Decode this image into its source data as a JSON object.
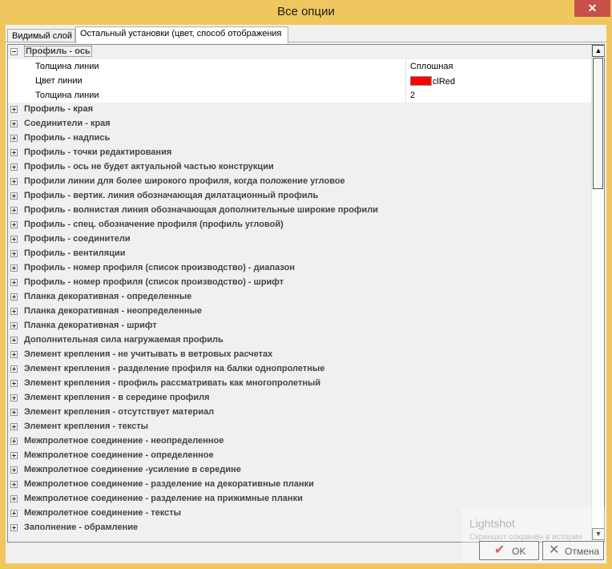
{
  "window": {
    "title": "Все опции",
    "close_glyph": "✕"
  },
  "tabs": [
    {
      "label": "Видимый слой",
      "active": false
    },
    {
      "label": "Остальный установки (цвет, способ отображения",
      "active": true
    }
  ],
  "tree": {
    "expanded_category": {
      "label": "Профиль - ось",
      "properties": [
        {
          "name": "Толщина линии",
          "value": "Сплошная"
        },
        {
          "name": "Цвет линии",
          "value": "clRed",
          "swatch_color": "#ff0000"
        },
        {
          "name": "Толщина линии",
          "value": "2"
        }
      ]
    },
    "categories": [
      "Профиль - края",
      "Соединители - края",
      "Профиль - надпись",
      "Профиль - точки редактирования",
      "Профиль - ось не будет актуальной частью конструкции",
      "Профили линии для более широкого профиля, когда положение угловое",
      "Профиль - вертик. линия обозначающая дилатационный профиль",
      "Профиль - волнистая линия обозначающая дополнительные широкие профили",
      "Профиль - спец. обозначение профиля (профиль угловой)",
      "Профиль - соединители",
      "Профиль - вентиляции",
      "Профиль - номер профиля (список производство) - диапазон",
      "Профиль - номер профиля (список производство) - шрифт",
      "Планка декоративная - определенные",
      "Планка декоративная - неопределенные",
      "Планка декоративная - шрифт",
      "Дополнительная сила нагружаемая профиль",
      "Элемент крепления - не учитывать в ветровых расчетах",
      "Элемент крепления - разделение профиля на балки однопролетные",
      "Элемент крепления - профиль рассматривать как многопролетный",
      "Элемент крепления - в середине профиля",
      "Элемент крепления - отсутствует материал",
      "Элемент крепления - тексты",
      "Межпролетное соединение - неопределенное",
      "Межпролетное соединение - определенное",
      "Межпролетное соединение -усиление в середине",
      "Межпролетное соединение - разделение на декоративные планки",
      "Межпролетное соединение - разделение на прижимные планки",
      "Межпролетное соединение - тексты",
      "Заполнение - обрамление"
    ]
  },
  "scrollbar": {
    "up_glyph": "▲",
    "down_glyph": "▼"
  },
  "buttons": {
    "ok": {
      "label": "OK",
      "icon": "checkmark-icon",
      "glyph": "✔"
    },
    "cancel": {
      "label": "Отмена",
      "icon": "x-icon",
      "glyph": "✕"
    }
  },
  "watermark": {
    "title": "Lightshot",
    "subtitle": "Скриншот сохранён в истории"
  },
  "colors": {
    "titlebar": "#f0c75e",
    "close_button": "#c7504a",
    "swatch": "#ff0000"
  }
}
